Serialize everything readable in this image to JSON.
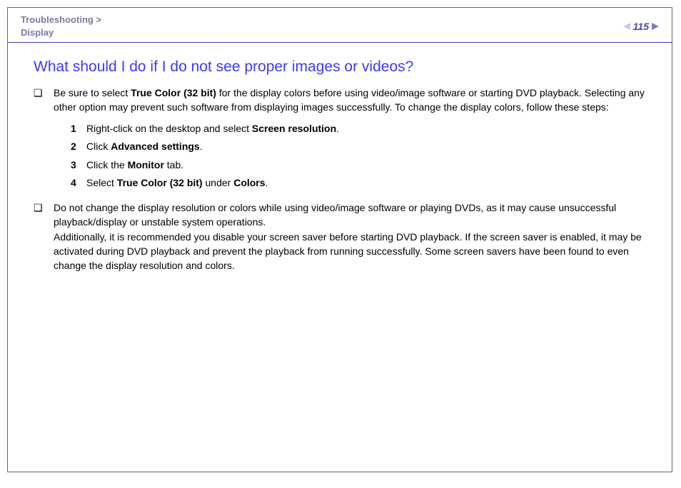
{
  "header": {
    "breadcrumb_line1": "Troubleshooting >",
    "breadcrumb_line2": "Display",
    "page_number": "115"
  },
  "title": "What should I do if I do not see proper images or videos?",
  "bullet_symbol": "❑",
  "bullets": [
    {
      "pre1": "Be sure to select ",
      "b1": "True Color (32 bit)",
      "post1": " for the display colors before using video/image software or starting DVD playback. Selecting any other option may prevent such software from displaying images successfully. To change the display colors, follow these steps:"
    },
    {
      "para1": "Do not change the display resolution or colors while using video/image software or playing DVDs, as it may cause unsuccessful playback/display or unstable system operations.",
      "para2": "Additionally, it is recommended you disable your screen saver before starting DVD playback. If the screen saver is enabled, it may be activated during DVD playback and prevent the playback from running successfully. Some screen savers have been found to even change the display resolution and colors."
    }
  ],
  "steps": [
    {
      "num": "1",
      "pre": "Right-click on the desktop and select ",
      "b": "Screen resolution",
      "post": "."
    },
    {
      "num": "2",
      "pre": "Click ",
      "b": "Advanced settings",
      "post": "."
    },
    {
      "num": "3",
      "pre": "Click the ",
      "b": "Monitor",
      "post": " tab."
    },
    {
      "num": "4",
      "pre": "Select ",
      "b": "True Color (32 bit)",
      "mid": " under ",
      "b2": "Colors",
      "post": "."
    }
  ]
}
